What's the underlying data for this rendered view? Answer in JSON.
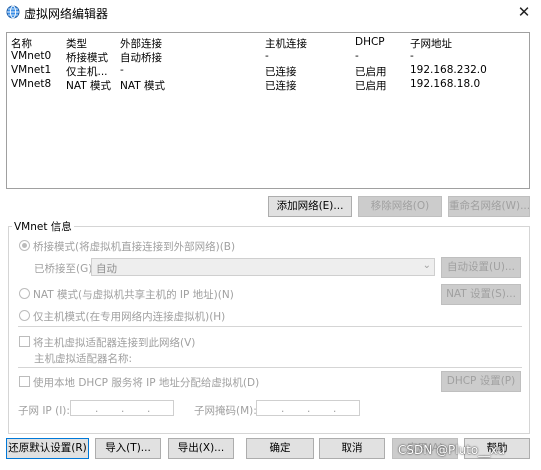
{
  "window": {
    "title": "虚拟网络编辑器",
    "close_glyph": "✕"
  },
  "network_list": {
    "columns": [
      "名称",
      "类型",
      "外部连接",
      "主机连接",
      "DHCP",
      "子网地址"
    ],
    "rows": [
      [
        "VMnet0",
        "桥接模式",
        "自动桥接",
        "-",
        "-",
        "-"
      ],
      [
        "VMnet1",
        "仅主机...",
        "-",
        "已连接",
        "已启用",
        "192.168.232.0"
      ],
      [
        "VMnet8",
        "NAT 模式",
        "NAT 模式",
        "已连接",
        "已启用",
        "192.168.18.0"
      ]
    ]
  },
  "list_buttons": {
    "add": "添加网络(E)...",
    "remove": "移除网络(O)",
    "rename": "重命名网络(W)..."
  },
  "vmnet_info": {
    "legend": "VMnet 信息",
    "bridge_mode": "桥接模式(将虚拟机直接连接到外部网络)(B)",
    "bridged_to_label": "已桥接至(G):",
    "bridged_to_value": "自动",
    "auto_settings": "自动设置(U)...",
    "nat_mode": "NAT 模式(与虚拟机共享主机的 IP 地址)(N)",
    "nat_settings": "NAT 设置(S)...",
    "host_only": "仅主机模式(在专用网络内连接虚拟机)(H)",
    "connect_adapter": "将主机虚拟适配器连接到此网络(V)",
    "adapter_name_label": "主机虚拟适配器名称:",
    "use_dhcp": "使用本地 DHCP 服务将 IP 地址分配给虚拟机(D)",
    "dhcp_settings": "DHCP 设置(P)",
    "subnet_ip_label": "子网 IP (I):",
    "subnet_mask_label": "子网掩码(M):"
  },
  "footer_buttons": {
    "restore": "还原默认设置(R)",
    "import": "导入(T)...",
    "export": "导出(X)...",
    "ok": "确定",
    "cancel": "取消",
    "apply": "应用(A)",
    "help": "帮助"
  },
  "watermark": "CSDN @Pluto__xu"
}
